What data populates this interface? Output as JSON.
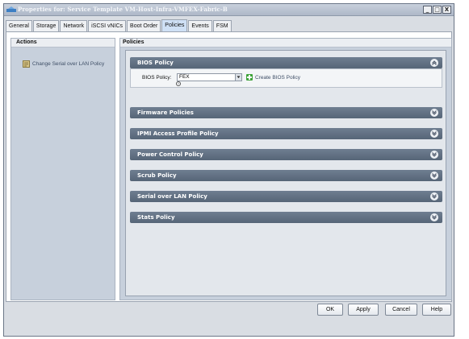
{
  "window": {
    "title": "Properties for: Service Template VM-Host-Infra-VMFEX-Fabric-B",
    "controls": {
      "minimize": "_",
      "maximize": "□",
      "close": "X"
    }
  },
  "tabs": [
    {
      "label": "General"
    },
    {
      "label": "Storage"
    },
    {
      "label": "Network"
    },
    {
      "label": "iSCSI vNICs"
    },
    {
      "label": "Boot Order"
    },
    {
      "label": "Policies",
      "active": true
    },
    {
      "label": "Events"
    },
    {
      "label": "FSM"
    }
  ],
  "actions": {
    "heading": "Actions",
    "items": [
      {
        "label": "Change Serial over LAN Policy",
        "icon": "serial-policy-icon"
      }
    ]
  },
  "policies": {
    "heading": "Policies",
    "bios": {
      "title": "BIOS Policy",
      "field_label": "BIOS Policy:",
      "selected_value": "FEX",
      "create_link": "Create BIOS Policy"
    },
    "sections": [
      {
        "title": "Firmware Policies"
      },
      {
        "title": "IPMI Access Profile Policy"
      },
      {
        "title": "Power Control Policy"
      },
      {
        "title": "Scrub Policy"
      },
      {
        "title": "Serial over LAN Policy"
      },
      {
        "title": "Stats Policy"
      }
    ]
  },
  "footer": {
    "ok": "OK",
    "apply": "Apply",
    "cancel": "Cancel",
    "help": "Help"
  },
  "colors": {
    "section_bar": "#5f6e81",
    "panel_bg": "#c7d0dc",
    "active_tab": "#cfe0f5"
  }
}
